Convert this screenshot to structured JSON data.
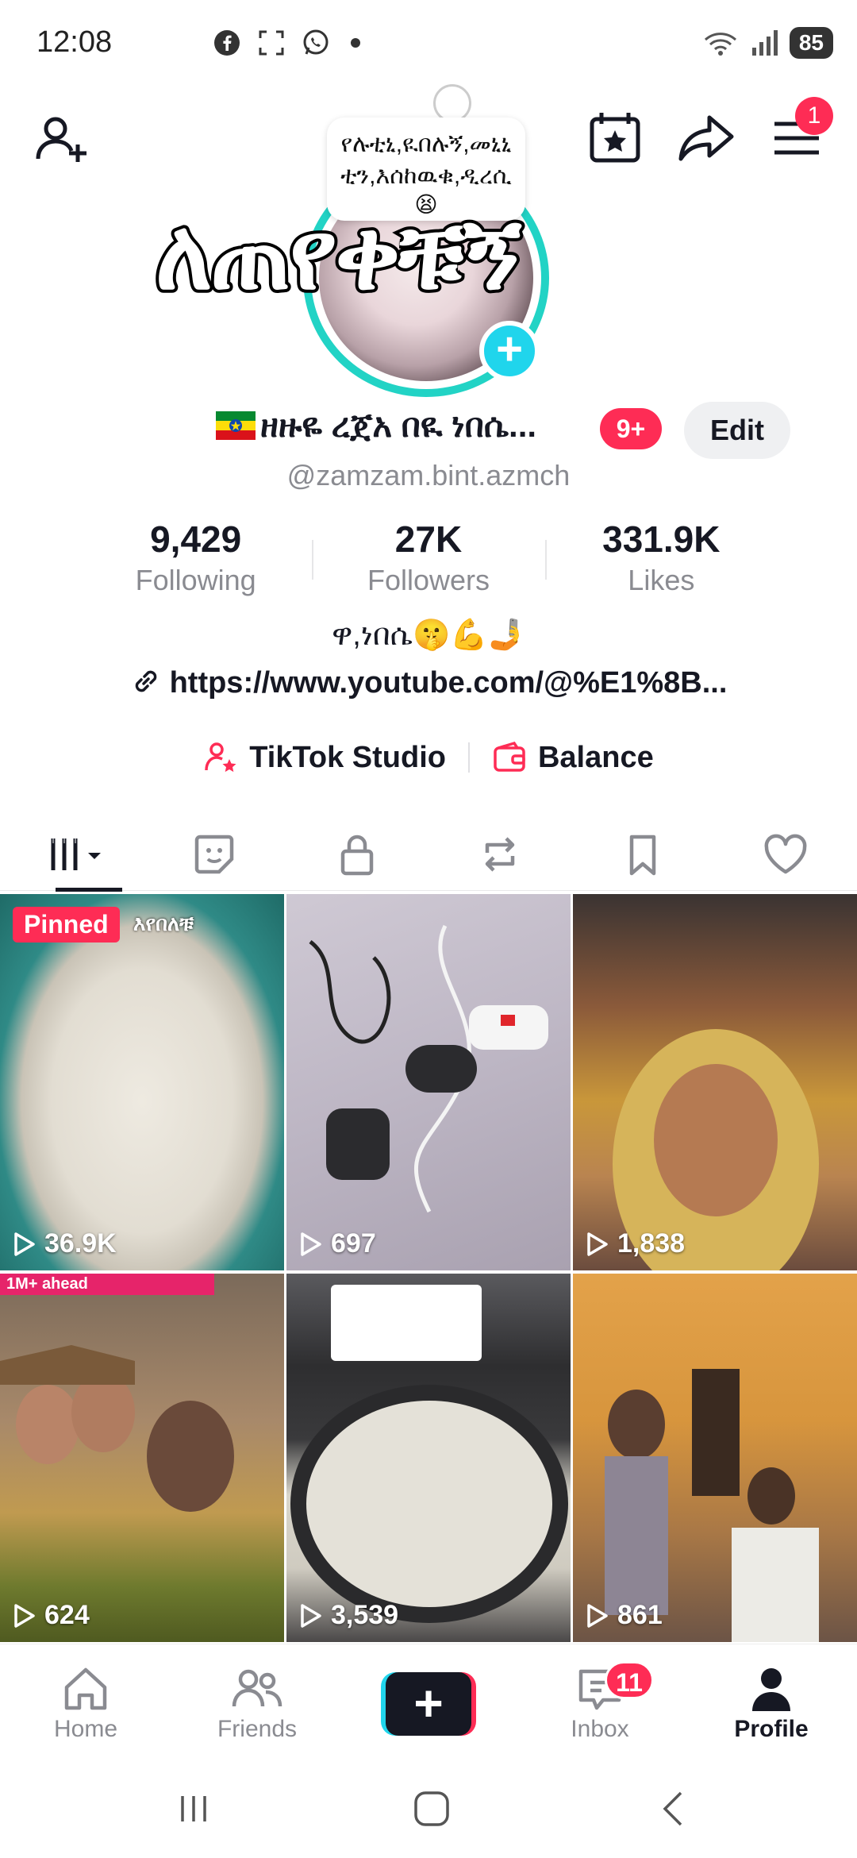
{
  "status_bar": {
    "time": "12:08",
    "battery": "85",
    "icons_left": [
      "facebook-icon",
      "screenshot-icon",
      "whatsapp-icon",
      "dot-icon"
    ],
    "icons_right": [
      "wifi-icon",
      "signal-icon",
      "battery-icon"
    ]
  },
  "header": {
    "menu_badge": "1"
  },
  "profile": {
    "note_text": "የሉቲኒ,ዪበሉኝ,መኒኒ ቲን,እሰከዉቁ,ዲረሲ",
    "note_emoji": "😫",
    "sticker_text": "ለጠየቀቹኝ",
    "display_name": "ዘዙዬ ረጀአ በዪ ነበሴ...",
    "notification_badge": "9+",
    "edit_label": "Edit",
    "username": "@zamzam.bint.azmch"
  },
  "stats": [
    {
      "value": "9,429",
      "label": "Following"
    },
    {
      "value": "27K",
      "label": "Followers"
    },
    {
      "value": "331.9K",
      "label": "Likes"
    }
  ],
  "bio": "ዋ,ነበሴ🤫💪🤳",
  "link": "https://www.youtube.com/@%E1%8B...",
  "tools": {
    "studio": "TikTok Studio",
    "balance": "Balance"
  },
  "tabs": [
    "videos-grid-icon",
    "stickers-icon",
    "lock-icon",
    "repost-icon",
    "bookmark-icon",
    "heart-icon"
  ],
  "videos": [
    {
      "views": "36.9K",
      "pinned_label": "Pinned",
      "caption": "እየበለቹ"
    },
    {
      "views": "697"
    },
    {
      "views": "1,838"
    },
    {
      "views": "624",
      "caption": "1M+ ahead"
    },
    {
      "views": "3,539"
    },
    {
      "views": "861"
    }
  ],
  "bottom_nav": {
    "home": "Home",
    "friends": "Friends",
    "inbox": "Inbox",
    "inbox_badge": "11",
    "profile": "Profile"
  },
  "colors": {
    "accent_red": "#fe2c55",
    "accent_cyan": "#20d5ec",
    "text_primary": "#161823",
    "text_secondary": "#8a8b91"
  }
}
